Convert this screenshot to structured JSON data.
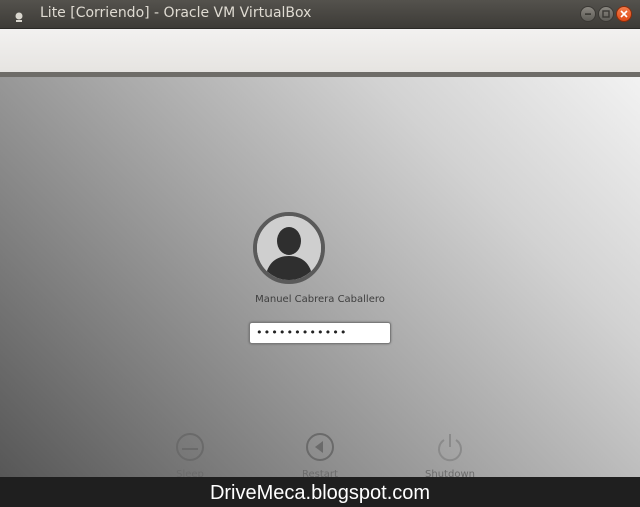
{
  "window": {
    "title": "Lite [Corriendo] - Oracle VM VirtualBox"
  },
  "login": {
    "username": "Manuel Cabrera Caballero",
    "password_mask": "••••••••••••"
  },
  "power_actions": [
    {
      "label": "Sleep",
      "icon": "sleep-icon"
    },
    {
      "label": "Restart",
      "icon": "restart-icon"
    },
    {
      "label": "Shutdown",
      "icon": "power-icon"
    }
  ],
  "watermark": "DriveMeca.blogspot.com",
  "colors": {
    "titlebar": "#3d3b37",
    "close_button": "#df4a16",
    "toolbar": "#ecebe9",
    "watermark_bar": "#1f1f1f"
  }
}
